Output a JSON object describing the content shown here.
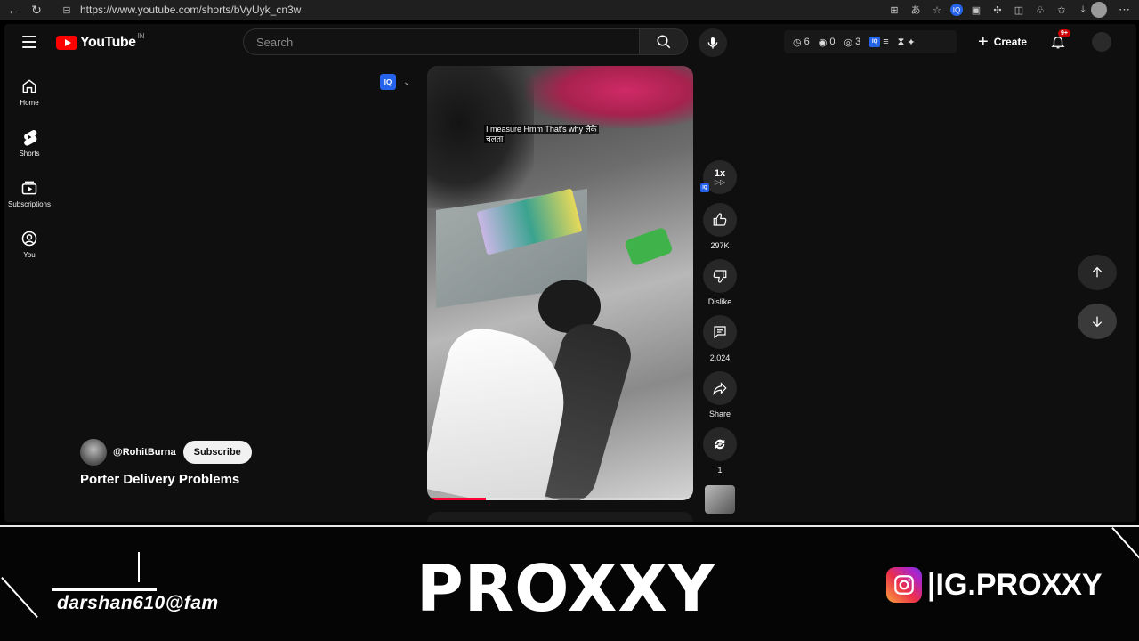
{
  "browser": {
    "url": "https://www.youtube.com/shorts/bVyUyk_cn3w"
  },
  "masthead": {
    "logo_text": "YouTube",
    "country_code": "IN",
    "search_placeholder": "Search",
    "counters": {
      "timer": "6",
      "views_a": "0",
      "views_b": "3"
    },
    "create_label": "Create",
    "notifications_badge": "9+"
  },
  "sidebar": {
    "items": [
      {
        "label": "Home",
        "icon": "home-icon"
      },
      {
        "label": "Shorts",
        "icon": "shorts-icon"
      },
      {
        "label": "Subscriptions",
        "icon": "subscriptions-icon"
      },
      {
        "label": "You",
        "icon": "you-icon"
      }
    ]
  },
  "video": {
    "caption_line1": "I measure Hmm That's why लेके",
    "caption_line2": "चलता",
    "progress": 0.22
  },
  "actions": {
    "speed_main": "1x",
    "speed_sub": "▷▷",
    "like_count": "297K",
    "dislike_label": "Dislike",
    "comment_count": "2,024",
    "share_label": "Share",
    "remix_count": "1"
  },
  "channel": {
    "handle": "@RohitBurna",
    "subscribe_label": "Subscribe",
    "title": "Porter Delivery Problems"
  },
  "overlay": {
    "left_text": "darshan610@fam",
    "brand": "PROXXY",
    "ig_handle": "|IG.PROXXY"
  },
  "colors": {
    "yt_red": "#ff0000",
    "progress_red": "#ff0033",
    "iq_blue": "#2563eb",
    "background": "#0f0f0f"
  }
}
